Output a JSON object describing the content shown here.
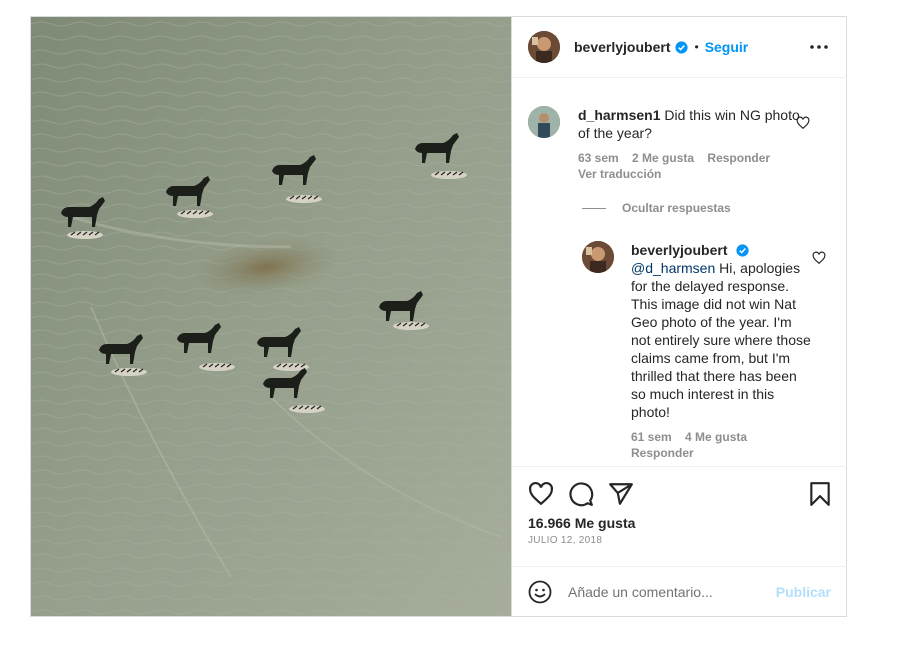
{
  "post": {
    "author": "beverlyjoubert",
    "follow_label": "Seguir",
    "separator": "•",
    "photo_alt_icon": "aerial-zebras-photo",
    "likes": "16.966 Me gusta",
    "date": "JULIO 12, 2018"
  },
  "comments": [
    {
      "user": "d_harmsen1",
      "text": "Did this win NG photo of the year?",
      "time": "63 sem",
      "likes": "2 Me gusta",
      "reply_label": "Responder",
      "translate_label": "Ver traducción"
    }
  ],
  "hide_replies_label": "Ocultar respuestas",
  "reply": {
    "user": "beverlyjoubert",
    "mention": "@d_harmsen",
    "text": " Hi, apologies for the delayed response. This image did not win Nat Geo photo of the year. I'm not entirely sure where those claims came from, but I'm thrilled that there has been so much interest in this photo!",
    "time": "61 sem",
    "likes": "4 Me gusta",
    "reply_label": "Responder"
  },
  "composer": {
    "placeholder": "Añade un comentario...",
    "publish_label": "Publicar"
  },
  "colors": {
    "accent": "#0095f6",
    "publish_disabled": "#b2dffc",
    "muted": "#8e8e8e"
  }
}
